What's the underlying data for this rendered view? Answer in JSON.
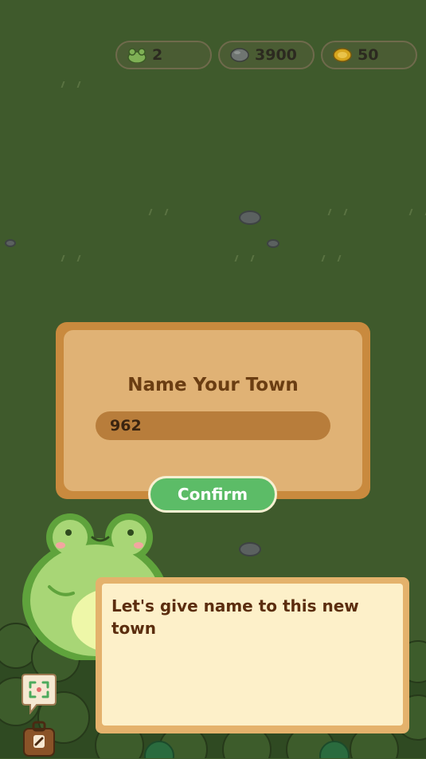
{
  "resources": {
    "frogs": {
      "icon": "frog-icon",
      "value": "2"
    },
    "stones": {
      "icon": "stone-icon",
      "value": "3900"
    },
    "coins": {
      "icon": "coin-icon",
      "value": "50"
    }
  },
  "dialog": {
    "title": "Name Your Town",
    "input_value": "962",
    "confirm_label": "Confirm"
  },
  "speech": {
    "text": "Let's give name to this new town"
  },
  "side_buttons": [
    {
      "icon": "expand-view-icon"
    },
    {
      "icon": "suitcase-icon"
    }
  ],
  "colors": {
    "background": "#3f5a2c",
    "dialog_border": "#c98a3e",
    "dialog_fill": "#e0b275",
    "confirm_green": "#5cbc67",
    "frog_green": "#a8d676",
    "speech_bg": "#fdf0c9"
  }
}
